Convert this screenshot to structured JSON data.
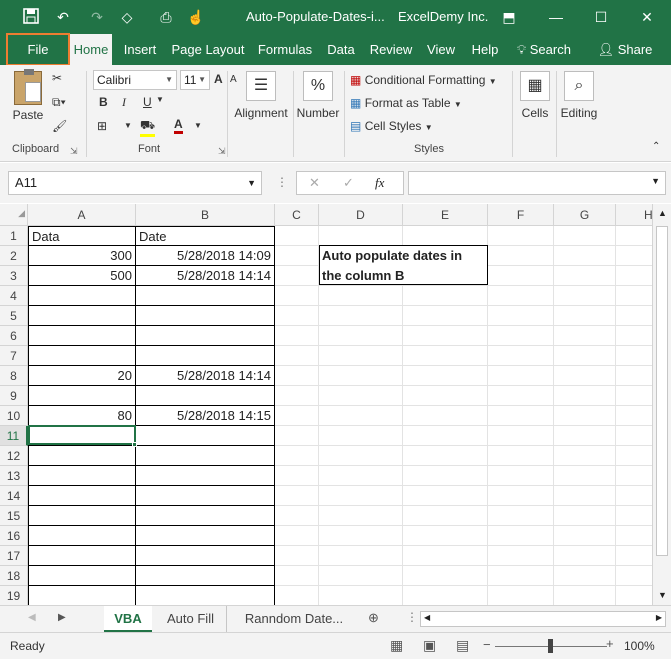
{
  "titlebar": {
    "doc_title": "Auto-Populate-Dates-i...",
    "company": "ExcelDemy Inc.",
    "icons": [
      "save-icon",
      "undo-icon",
      "redo-icon",
      "touch-mode-icon",
      "print-preview-icon",
      "touch-icon",
      "ribbon-display-icon",
      "minimize-icon",
      "maximize-icon",
      "close-icon"
    ]
  },
  "tabs": [
    {
      "label": "File"
    },
    {
      "label": "Home"
    },
    {
      "label": "Insert"
    },
    {
      "label": "Page Layout"
    },
    {
      "label": "Formulas"
    },
    {
      "label": "Data"
    },
    {
      "label": "Review"
    },
    {
      "label": "View"
    },
    {
      "label": "Help"
    }
  ],
  "search_label": "Search",
  "share_label": "Share",
  "ribbon": {
    "clipboard": {
      "paste": "Paste",
      "group": "Clipboard"
    },
    "font": {
      "name": "Calibri",
      "size": "11",
      "group": "Font",
      "bold": "B",
      "italic": "I",
      "underline": "U",
      "grow": "A",
      "shrink": "A",
      "color_a": "A"
    },
    "alignment": {
      "label": "Alignment"
    },
    "number": {
      "label": "Number",
      "symbol": "%"
    },
    "styles": {
      "cond": "Conditional Formatting",
      "table": "Format as Table",
      "cell": "Cell Styles",
      "group": "Styles"
    },
    "cells": {
      "label": "Cells"
    },
    "editing": {
      "label": "Editing"
    }
  },
  "formula_bar": {
    "name_box": "A11",
    "fx": "fx",
    "value": ""
  },
  "sheet": {
    "columns": [
      "A",
      "B",
      "C",
      "D",
      "E",
      "F",
      "G",
      "H"
    ],
    "rows": [
      "1",
      "2",
      "3",
      "4",
      "5",
      "6",
      "7",
      "8",
      "9",
      "10",
      "11",
      "12",
      "13",
      "14",
      "15",
      "16",
      "17",
      "18",
      "19"
    ],
    "cells": {
      "A1": "Data",
      "B1": "Date",
      "A2": "300",
      "B2": "5/28/2018 14:09",
      "A3": "500",
      "B3": "5/28/2018 14:14",
      "A8": "20",
      "B8": "5/28/2018 14:14",
      "A10": "80",
      "B10": "5/28/2018 14:15"
    },
    "note": "Auto populate dates in the column B"
  },
  "sheet_tabs": [
    "VBA",
    "Auto Fill",
    "Ranndom Date..."
  ],
  "status": {
    "ready": "Ready",
    "zoom": "100%"
  },
  "colors": {
    "accent": "#217346",
    "highlight": "#ed7d31"
  }
}
